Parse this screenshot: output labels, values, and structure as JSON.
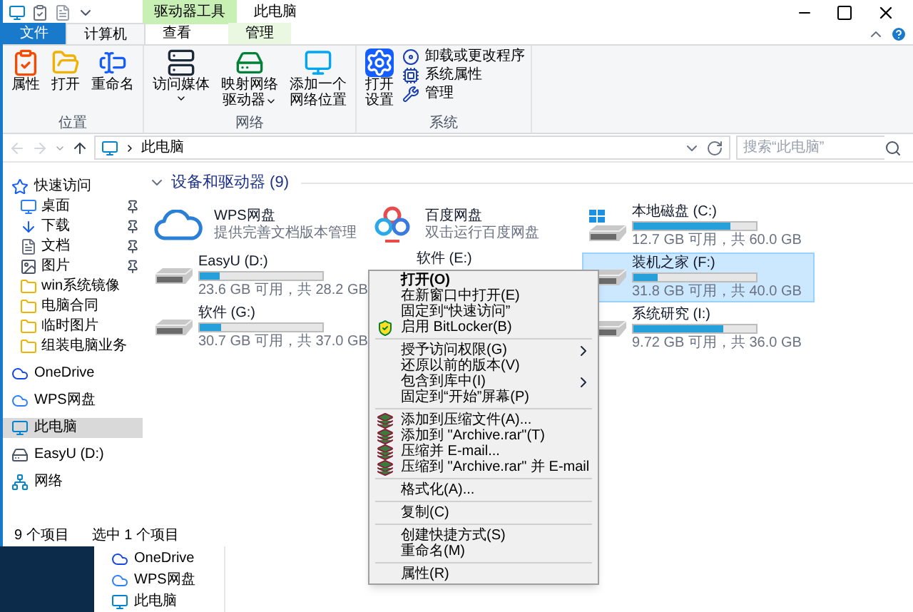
{
  "title_bar": {
    "contextual_tab": "驱动器工具",
    "title": "此电脑"
  },
  "ribbon_tabs": [
    {
      "label": "文件",
      "kind": "file",
      "selected": false
    },
    {
      "label": "计算机",
      "kind": "tab",
      "selected": true
    },
    {
      "label": "查看",
      "kind": "tab",
      "selected": false
    },
    {
      "label": "管理",
      "kind": "contextual",
      "selected": false
    }
  ],
  "ribbon_groups": [
    {
      "label": "位置",
      "buttons": [
        {
          "lines": [
            "属性"
          ],
          "dropdown": false
        },
        {
          "lines": [
            "打开"
          ],
          "dropdown": false
        },
        {
          "lines": [
            "重命名"
          ],
          "dropdown": false
        }
      ]
    },
    {
      "label": "网络",
      "buttons": [
        {
          "lines": [
            "访问媒体"
          ],
          "dropdown": true
        },
        {
          "lines": [
            "映射网络",
            "驱动器"
          ],
          "dropdown": true
        },
        {
          "lines": [
            "添加一个",
            "网络位置"
          ],
          "dropdown": false
        }
      ]
    },
    {
      "label": "系统",
      "buttons": [
        {
          "lines": [
            "打开",
            "设置"
          ],
          "dropdown": false
        }
      ],
      "small_buttons": [
        "卸载或更改程序",
        "系统属性",
        "管理"
      ]
    }
  ],
  "address_bar": {
    "path": "此电脑",
    "search_placeholder": "搜索“此电脑”"
  },
  "sidebar": {
    "items": [
      {
        "label": "快速访问",
        "kind": "quick",
        "selected": false,
        "children": [
          {
            "label": "桌面",
            "kind": "desktop",
            "pinned": true
          },
          {
            "label": "下载",
            "kind": "download",
            "pinned": true
          },
          {
            "label": "文档",
            "kind": "docs",
            "pinned": true
          },
          {
            "label": "图片",
            "kind": "pictures",
            "pinned": true
          },
          {
            "label": "win系统镜像",
            "kind": "folder",
            "pinned": false
          },
          {
            "label": "电脑合同",
            "kind": "folder",
            "pinned": false
          },
          {
            "label": "临时图片",
            "kind": "folder",
            "pinned": false
          },
          {
            "label": "组装电脑业务",
            "kind": "folder",
            "pinned": false
          }
        ]
      },
      {
        "label": "OneDrive",
        "kind": "onedrive",
        "selected": false
      },
      {
        "label": "WPS网盘",
        "kind": "wps",
        "selected": false
      },
      {
        "label": "此电脑",
        "kind": "pc",
        "selected": true
      },
      {
        "label": "EasyU (D:)",
        "kind": "drive",
        "selected": false
      },
      {
        "label": "网络",
        "kind": "network",
        "selected": false
      }
    ]
  },
  "section": {
    "title": "设备和驱动器 (9)",
    "expanded": true
  },
  "drive_columns": [
    [
      {
        "kind": "cloud",
        "name": "WPS网盘",
        "subtitle": "提供完善文档版本管理"
      },
      {
        "kind": "drive",
        "name": "EasyU (D:)",
        "level": 0.16,
        "reading": "23.6 GB 可用，共 28.2 GB",
        "selected": false
      },
      {
        "kind": "drive",
        "name": "软件 (G:)",
        "level": 0.17,
        "reading": "30.7 GB 可用，共 37.0 GB",
        "selected": false
      }
    ],
    [
      {
        "kind": "baidu",
        "name": "百度网盘",
        "subtitle": "双击运行百度网盘"
      },
      {
        "kind": "covered",
        "name": "软件 (E:)"
      }
    ],
    [
      {
        "kind": "system",
        "name": "本地磁盘 (C:)",
        "level": 0.79,
        "reading": "12.7 GB 可用，共 60.0 GB",
        "selected": false
      },
      {
        "kind": "drive",
        "name": "装机之家 (F:)",
        "level": 0.2,
        "reading": "31.8 GB 可用，共 40.0 GB",
        "selected": true
      },
      {
        "kind": "drive",
        "name": "系统研究 (I:)",
        "level": 0.73,
        "reading": "9.72 GB 可用，共 36.0 GB",
        "selected": false
      }
    ]
  ],
  "context_menu": [
    {
      "kind": "item",
      "label": "打开(O)",
      "default": true
    },
    {
      "kind": "item",
      "label": "在新窗口中打开(E)",
      "default": false
    },
    {
      "kind": "item",
      "label": "固定到“快速访问”",
      "default": false
    },
    {
      "kind": "shield",
      "label": "启用 BitLocker(B)",
      "default": false
    },
    {
      "kind": "separator"
    },
    {
      "kind": "submenu",
      "label": "授予访问权限(G)",
      "default": false
    },
    {
      "kind": "item",
      "label": "还原以前的版本(V)",
      "default": false
    },
    {
      "kind": "submenu",
      "label": "包含到库中(I)",
      "default": false
    },
    {
      "kind": "item",
      "label": "固定到“开始”屏幕(P)",
      "default": false
    },
    {
      "kind": "separator"
    },
    {
      "kind": "rar",
      "label": "添加到压缩文件(A)...",
      "default": false
    },
    {
      "kind": "rar",
      "label": "添加到 \"Archive.rar\"(T)",
      "default": false
    },
    {
      "kind": "rar",
      "label": "压缩并 E-mail...",
      "default": false
    },
    {
      "kind": "rar",
      "label": "压缩到 \"Archive.rar\" 并 E-mail",
      "default": false
    },
    {
      "kind": "separator"
    },
    {
      "kind": "item",
      "label": "格式化(A)...",
      "default": false
    },
    {
      "kind": "separator"
    },
    {
      "kind": "item",
      "label": "复制(C)",
      "default": false
    },
    {
      "kind": "separator"
    },
    {
      "kind": "item",
      "label": "创建快捷方式(S)",
      "default": false
    },
    {
      "kind": "item",
      "label": "重命名(M)",
      "default": false
    },
    {
      "kind": "separator"
    },
    {
      "kind": "item",
      "label": "属性(R)",
      "default": false
    }
  ],
  "status_bar": {
    "count": "9 个项目",
    "selection": "选中 1 个项目"
  },
  "background_window": {
    "items": [
      {
        "label": "OneDrive",
        "kind": "onedrive"
      },
      {
        "label": "WPS网盘",
        "kind": "wps"
      },
      {
        "label": "此电脑",
        "kind": "pc"
      }
    ]
  }
}
